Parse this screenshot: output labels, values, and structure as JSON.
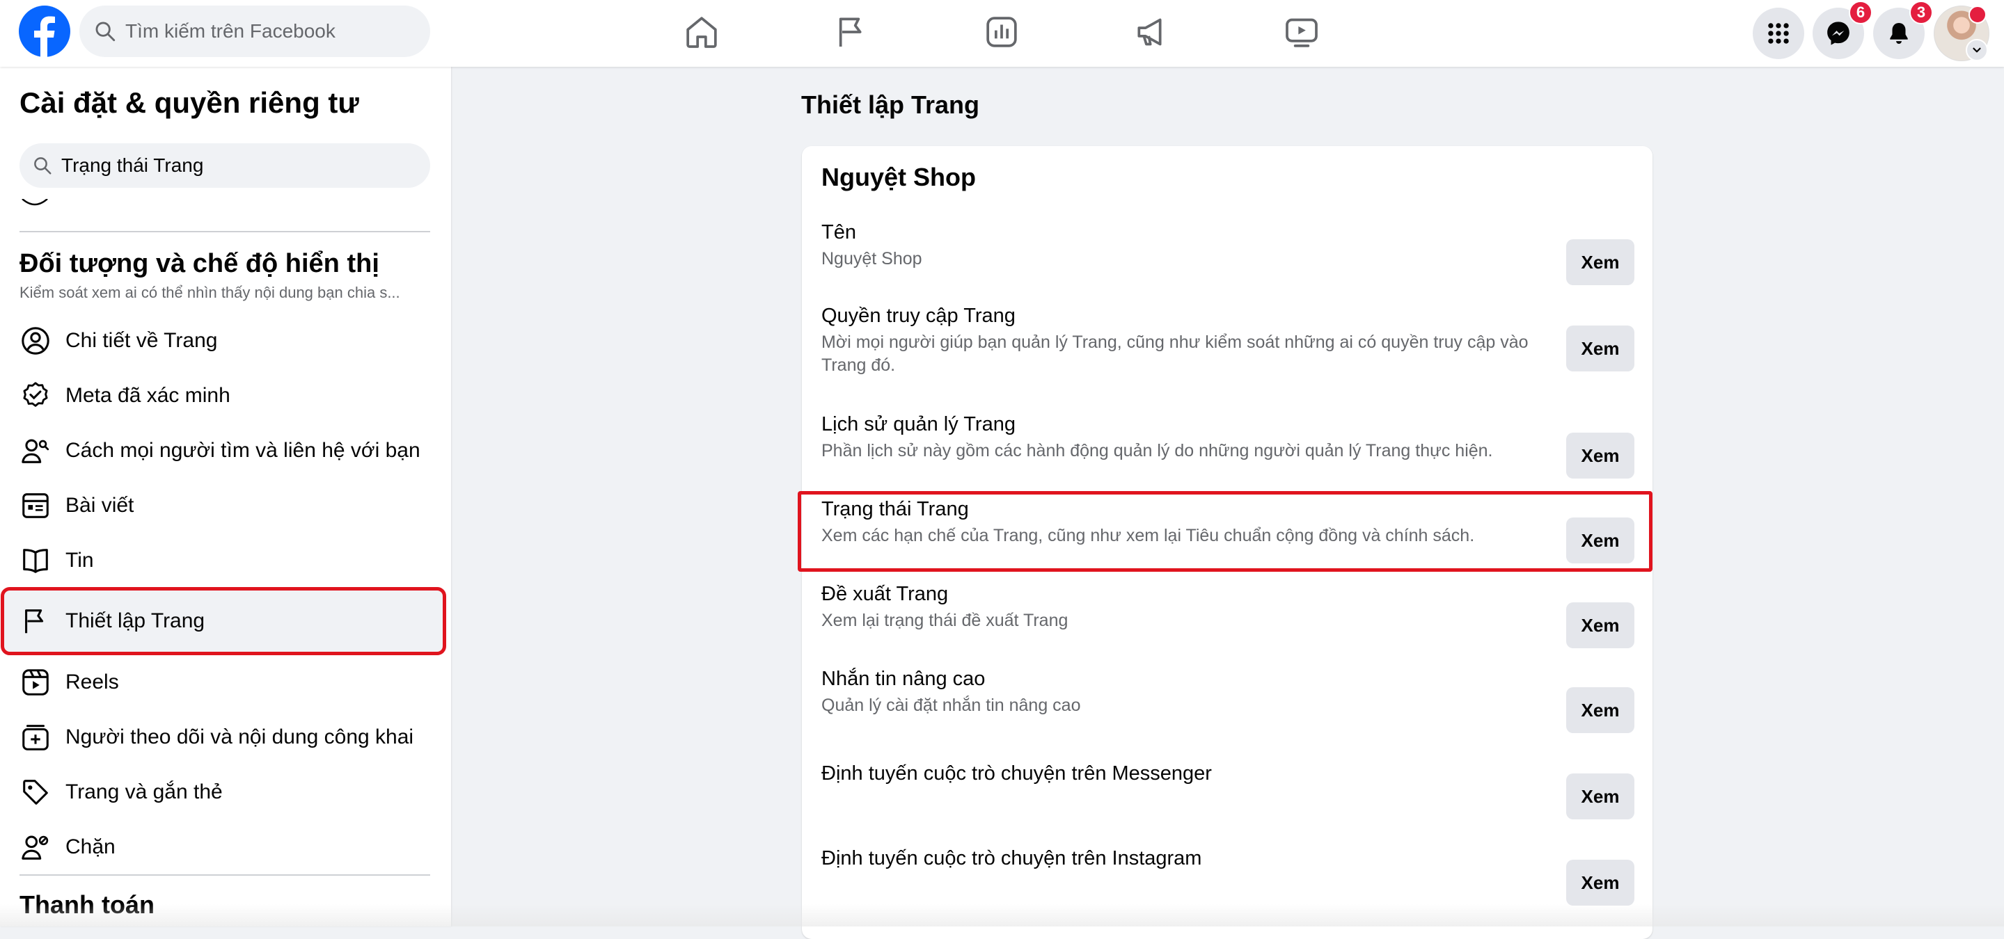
{
  "topbar": {
    "search_placeholder": "Tìm kiếm trên Facebook",
    "messenger_badge": "6",
    "notifications_badge": "3",
    "nav_icons": [
      "home-icon",
      "flag-icon",
      "insights-icon",
      "megaphone-icon",
      "video-icon"
    ]
  },
  "sidebar": {
    "title": "Cài đặt & quyền riêng tư",
    "search_value": "Trạng thái Trang",
    "section_title": "Đối tượng và chế độ hiển thị",
    "section_desc": "Kiểm soát xem ai có thể nhìn thấy nội dung bạn chia s...",
    "items": [
      {
        "label": "Chi tiết về Trang",
        "icon": "person-circle-icon"
      },
      {
        "label": "Meta đã xác minh",
        "icon": "verified-badge-icon"
      },
      {
        "label": "Cách mọi người tìm và liên hệ với bạn",
        "icon": "people-search-icon"
      },
      {
        "label": "Bài viết",
        "icon": "post-icon"
      },
      {
        "label": "Tin",
        "icon": "book-icon"
      },
      {
        "label": "Thiết lập Trang",
        "icon": "flag-icon",
        "selected": true
      },
      {
        "label": "Reels",
        "icon": "reels-icon"
      },
      {
        "label": "Người theo dõi và nội dung công khai",
        "icon": "add-box-icon"
      },
      {
        "label": "Trang và gắn thẻ",
        "icon": "tag-icon"
      },
      {
        "label": "Chặn",
        "icon": "block-user-icon"
      }
    ],
    "footer_section": "Thanh toán"
  },
  "main": {
    "title": "Thiết lập Trang",
    "card_title": "Nguyệt Shop",
    "button_label": "Xem",
    "rows": [
      {
        "title": "Tên",
        "desc": "Nguyệt Shop"
      },
      {
        "title": "Quyền truy cập Trang",
        "desc": "Mời mọi người giúp bạn quản lý Trang, cũng như kiểm soát những ai có quyền truy cập vào Trang đó."
      },
      {
        "title": "Lịch sử quản lý Trang",
        "desc": "Phần lịch sử này gồm các hành động quản lý do những người quản lý Trang thực hiện."
      },
      {
        "title": "Trạng thái Trang",
        "desc": "Xem các hạn chế của Trang, cũng như xem lại Tiêu chuẩn cộng đồng và chính sách."
      },
      {
        "title": "Đề xuất Trang",
        "desc": "Xem lại trạng thái đề xuất Trang"
      },
      {
        "title": "Nhắn tin nâng cao",
        "desc": "Quản lý cài đặt nhắn tin nâng cao"
      },
      {
        "title": "Định tuyến cuộc trò chuyện trên Messenger",
        "desc": ""
      },
      {
        "title": "Định tuyến cuộc trò chuyện trên Instagram",
        "desc": ""
      }
    ]
  },
  "colors": {
    "brand": "#0866ff",
    "highlight": "#e0141e",
    "badge": "#e41e3f"
  }
}
